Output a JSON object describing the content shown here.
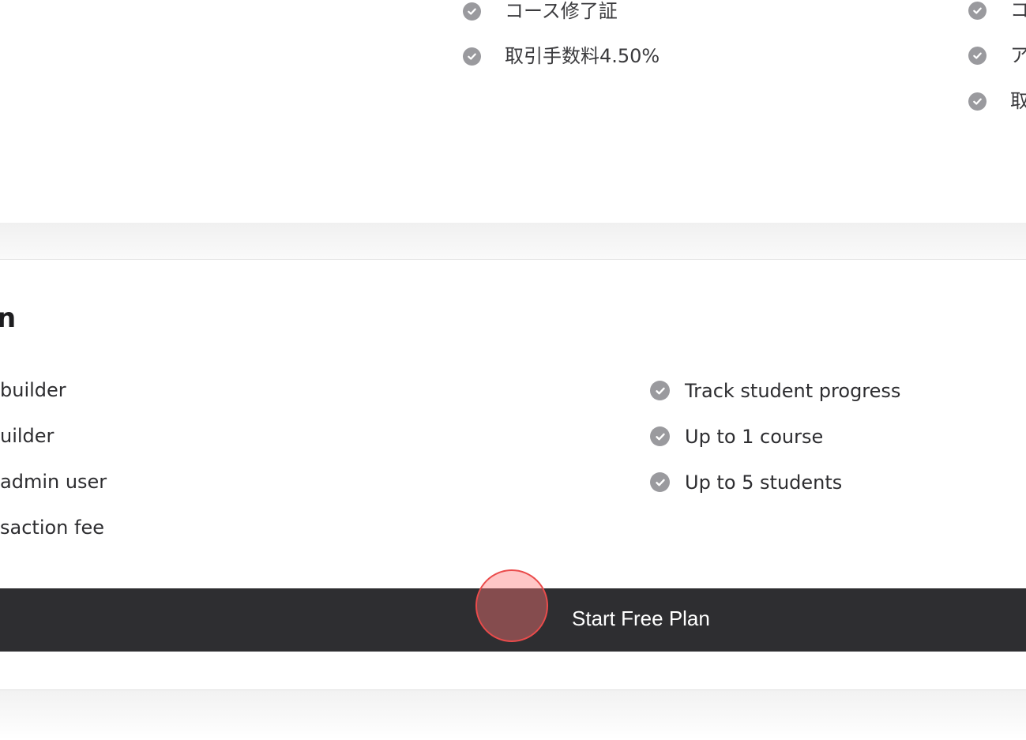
{
  "top_plans": {
    "middle_features": [
      "コース修了証",
      "取引手数料4.50%"
    ],
    "right_features_partial": [
      "コ",
      "ア",
      "取"
    ]
  },
  "free_plan": {
    "title_partial": "n",
    "left_features_partial": [
      "builder",
      "uilder",
      "admin user",
      "saction fee"
    ],
    "right_features": [
      "Track student progress",
      "Up to 1 course",
      "Up to 5 students"
    ],
    "cta_label": "Start Free Plan"
  },
  "icons": {
    "feature_check": "check-circle-icon"
  },
  "colors": {
    "check_icon": "#9a9a9e",
    "cta_background": "#2e2e31",
    "click_marker": "#ea4b4b"
  }
}
